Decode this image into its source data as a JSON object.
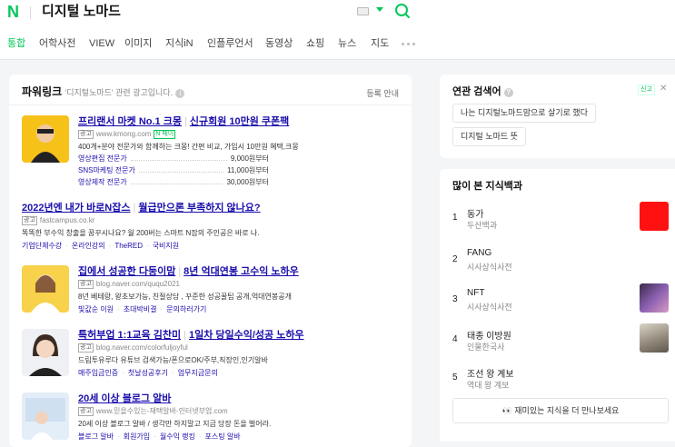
{
  "header": {
    "logo": "N",
    "query": "디지털 노마드"
  },
  "tabs": [
    "통합",
    "어학사전",
    "VIEW",
    "이미지",
    "지식iN",
    "인플루언서",
    "동영상",
    "쇼핑",
    "뉴스",
    "지도"
  ],
  "colors": {
    "accent": "#03c75a",
    "link": "#1a0dab"
  },
  "powerlink": {
    "title": "파워링크",
    "subtitle": "'디지털노마드' 관련 광고입니다.",
    "guide": "등록 안내",
    "ads": [
      {
        "title_a": "프리랜서 마켓 No.1 크몽",
        "title_b": "신규회원 10만원 쿠폰팩",
        "url": "www.kmong.com",
        "pay_badge": "N 페이",
        "desc": "400개+분야 전문가와 함께하는 크몽! 간편 비교, 가입시 10만원 혜택,크몽",
        "prices": [
          {
            "name": "영상편집 전문가",
            "price": "9,000원부터"
          },
          {
            "name": "SNS마케팅 전문가",
            "price": "11,000원부터"
          },
          {
            "name": "영상제작 전문가",
            "price": "30,000원부터"
          }
        ]
      },
      {
        "title_a": "2022년엔 내가 바로N잡스",
        "title_b": "월급만으론 부족하지 않나요?",
        "url": "fastcampus.co.kr",
        "desc": "똑똑한 부수익 창출을 꿈꾸시나요? 월 200버는 스마트 N잡의 주인공은 바로 나.",
        "links": [
          "기업단체수강",
          "온라인강의",
          "TheRED",
          "국비지원"
        ]
      },
      {
        "title_a": "집에서 성공한 다둥이맘",
        "title_b": "8년 억대연봉 고수익 노하우",
        "url": "blog.naver.com/ququ2021",
        "desc": "8년 베테랑, 왕초보가능, 친절상담 , 꾸준한 성공꿀팁 공개,억대연봉공개",
        "links": [
          "빛값순 이원",
          "초대박비결",
          "문의하러가기"
        ]
      },
      {
        "title_a": "특허부업 1:1교육 김찬미",
        "title_b": "1일차 당일수익/성공 노하우",
        "url": "blog.naver.com/colorfuljoyful",
        "desc": "드림투유루다 유튜브 검색가능/폰으로OK/주부,직장인,인기알바",
        "links": [
          "매주입금인증",
          "첫날성공후기",
          "업무지금문의"
        ]
      },
      {
        "title_a": "20세 이상 블로그 알바",
        "url": "www.믿을수있는-재택알바-인터넷부업.com",
        "desc": "20세 이상 블로그 알바 / 생각만 하지말고 지금 당장 돈을 벌어라.",
        "links": [
          "블로그 알바",
          "회원가입",
          "월수익 랭킹",
          "포스팅 알바"
        ]
      }
    ],
    "ad_badge": "광고"
  },
  "related": {
    "title": "연관 검색어",
    "ad_tag": "신고",
    "chips": [
      "나는 디지털노마드맘으로 살기로 했다",
      "디지털 노마드 뜻"
    ]
  },
  "knowledge": {
    "title": "많이 본 지식백과",
    "items": [
      {
        "rank": "1",
        "name": "동가",
        "src": "두산백과"
      },
      {
        "rank": "2",
        "name": "FANG",
        "src": "시사상식사전"
      },
      {
        "rank": "3",
        "name": "NFT",
        "src": "시사상식사전"
      },
      {
        "rank": "4",
        "name": "태종 이방원",
        "src": "인물한국사"
      },
      {
        "rank": "5",
        "name": "조선 왕 계보",
        "src": "역대 왕 계보"
      }
    ],
    "more": "재미있는 지식을 더 만나보세요"
  }
}
